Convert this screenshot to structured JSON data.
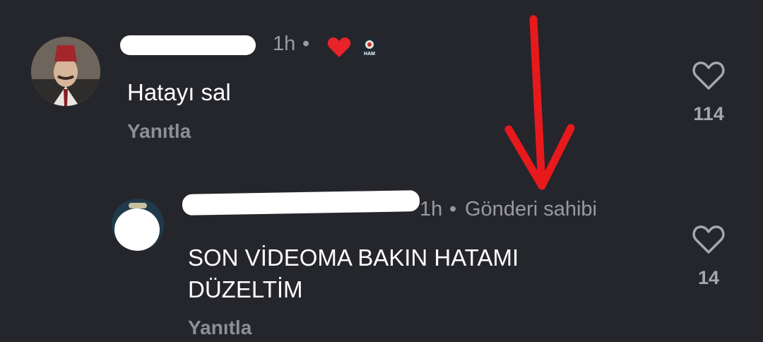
{
  "comments": [
    {
      "time": "1h",
      "separator": "•",
      "text": "Hatayı sal",
      "reply_label": "Yanıtla",
      "likes": "114",
      "creator_liked": true,
      "badge_text": "HAM"
    },
    {
      "time": "1h",
      "separator": "•",
      "author_tag": "Gönderi sahibi",
      "text_line1": "SON VİDEOMA BAKIN HATAMI",
      "text_line2": "DÜZELTİM",
      "reply_label": "Yanıtla",
      "likes": "14"
    }
  ],
  "annotation": {
    "type": "arrow",
    "color": "#e8191c"
  },
  "icons": [
    "heart-outline-icon",
    "heart-filled-icon",
    "channel-badge-icon"
  ],
  "colors": {
    "background": "#25262b",
    "muted": "#9a9ba1",
    "like_red": "#e8232a"
  }
}
